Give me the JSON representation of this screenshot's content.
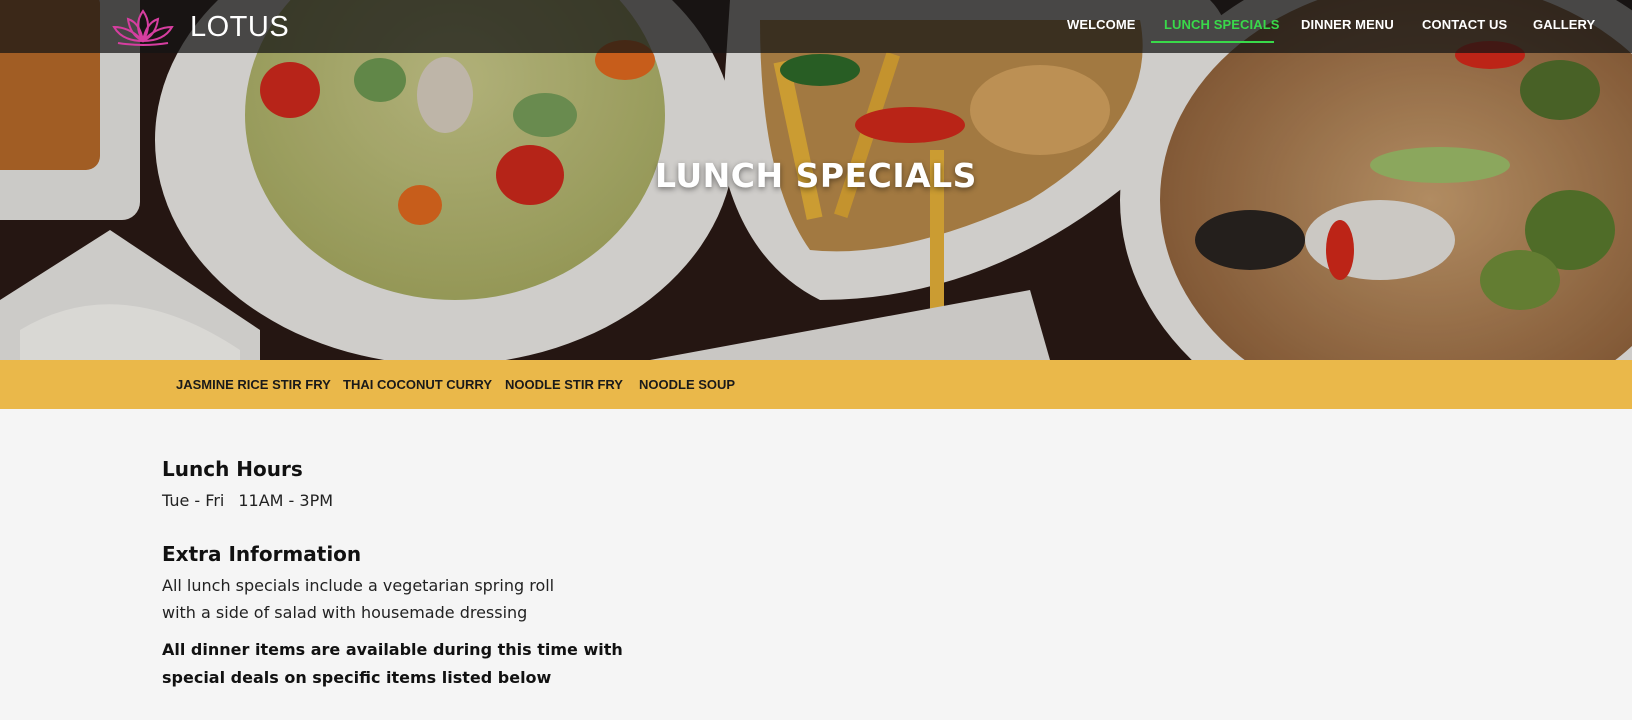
{
  "brand": {
    "name": "LOTUS",
    "logo_icon": "lotus-icon",
    "logo_color": "#d63ea0"
  },
  "nav": {
    "items": [
      {
        "label": "WELCOME",
        "active": false
      },
      {
        "label": "LUNCH SPECIALS",
        "active": true
      },
      {
        "label": "DINNER MENU",
        "active": false
      },
      {
        "label": "CONTACT US",
        "active": false
      },
      {
        "label": "GALLERY",
        "active": false
      }
    ],
    "active_color": "#39d94a"
  },
  "hero": {
    "title": "LUNCH SPECIALS"
  },
  "subnav": {
    "background": "#eab84a",
    "items": [
      {
        "label": "JASMINE RICE STIR FRY"
      },
      {
        "label": "THAI COCONUT CURRY"
      },
      {
        "label": "NOODLE STIR FRY"
      },
      {
        "label": "NOODLE SOUP"
      }
    ]
  },
  "content": {
    "lunch_hours": {
      "heading": "Lunch Hours",
      "days": "Tue - Fri",
      "time": "11AM - 3PM"
    },
    "extra": {
      "heading": "Extra Information",
      "line1": "All lunch specials include a vegetarian spring roll",
      "line2": "with a side of salad with housemade dressing",
      "bold_line1": "All dinner items are available during this time with",
      "bold_line2": "special deals on specific items listed below"
    }
  }
}
